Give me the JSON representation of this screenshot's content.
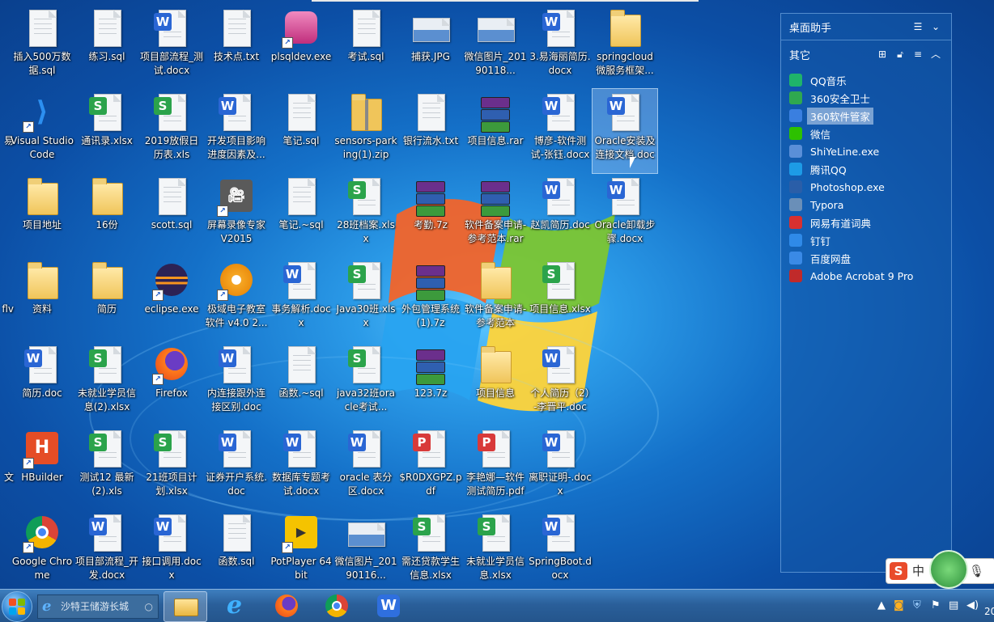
{
  "desktop": {
    "icons": [
      {
        "label": "插入500万数据.sql",
        "type": "doc"
      },
      {
        "label": "练习.sql",
        "type": "doc"
      },
      {
        "label": "项目部流程_测试.docx",
        "type": "word"
      },
      {
        "label": "技术点.txt",
        "type": "doc"
      },
      {
        "label": "plsqldev.exe",
        "type": "db"
      },
      {
        "label": "考试.sql",
        "type": "doc"
      },
      {
        "label": "捕获.JPG",
        "type": "img"
      },
      {
        "label": "微信图片_20190118...",
        "type": "img"
      },
      {
        "label": "3.易海丽简历.docx",
        "type": "word"
      },
      {
        "label": "springcloud微服务框架...",
        "type": "folder"
      },
      {
        "label": "易",
        "type": "partial"
      },
      {
        "label": "Visual Studio Code",
        "type": "vscode"
      },
      {
        "label": "通讯录.xlsx",
        "type": "excel"
      },
      {
        "label": "2019放假日历表.xls",
        "type": "excel"
      },
      {
        "label": "开发项目影响进度因素及...",
        "type": "word"
      },
      {
        "label": "笔记.sql",
        "type": "doc"
      },
      {
        "label": "sensors-parking(1).zip",
        "type": "zip"
      },
      {
        "label": "银行流水.txt",
        "type": "doc"
      },
      {
        "label": "项目信息.rar",
        "type": "rar"
      },
      {
        "label": "博彦-软件测试-张钰.docx",
        "type": "word"
      },
      {
        "label": "Oracle安装及连接文档.doc",
        "type": "word"
      },
      {
        "label": "项目地址",
        "type": "folder"
      },
      {
        "label": "16份",
        "type": "folder"
      },
      {
        "label": "scott.sql",
        "type": "doc"
      },
      {
        "label": "屏幕录像专家V2015",
        "type": "camera"
      },
      {
        "label": "笔记.~sql",
        "type": "doc"
      },
      {
        "label": "28班档案.xlsx",
        "type": "excel"
      },
      {
        "label": "考勤.7z",
        "type": "rar"
      },
      {
        "label": "软件备案申请-参考范本.rar",
        "type": "rar"
      },
      {
        "label": "赵凯简历.doc",
        "type": "word"
      },
      {
        "label": "Oracle卸载步骤.docx",
        "type": "word"
      },
      {
        "label": "flv",
        "type": "partial"
      },
      {
        "label": "资料",
        "type": "folder"
      },
      {
        "label": "简历",
        "type": "folder"
      },
      {
        "label": "eclipse.exe",
        "type": "eclipse"
      },
      {
        "label": "极域电子教室软件 v4.0 2...",
        "type": "orange"
      },
      {
        "label": "事务解析.docx",
        "type": "word"
      },
      {
        "label": "Java30班.xlsx",
        "type": "excel"
      },
      {
        "label": "外包管理系统(1).7z",
        "type": "rar"
      },
      {
        "label": "软件备案申请-参考范本",
        "type": "folder"
      },
      {
        "label": "项目信息.xlsx",
        "type": "excel"
      },
      {
        "label": "简历.doc",
        "type": "word"
      },
      {
        "label": "未就业学员信息(2).xlsx",
        "type": "excel"
      },
      {
        "label": "Firefox",
        "type": "firefox"
      },
      {
        "label": "内连接跟外连接区别.doc",
        "type": "word"
      },
      {
        "label": "函数.~sql",
        "type": "doc"
      },
      {
        "label": "java32班oracle考试...",
        "type": "excel"
      },
      {
        "label": "123.7z",
        "type": "rar"
      },
      {
        "label": "项目信息",
        "type": "folder"
      },
      {
        "label": "个人简历（2）-李晋平.doc",
        "type": "word"
      },
      {
        "label": "文",
        "type": "partial"
      },
      {
        "label": "HBuilder",
        "type": "hbuilder"
      },
      {
        "label": "测试12 最新(2).xls",
        "type": "excel"
      },
      {
        "label": "21班项目计划.xlsx",
        "type": "excel"
      },
      {
        "label": "证券开户系统.doc",
        "type": "word"
      },
      {
        "label": "数据库专题考试.docx",
        "type": "word"
      },
      {
        "label": "oracle 表分区.docx",
        "type": "word"
      },
      {
        "label": "$R0DXGPZ.pdf",
        "type": "pdf"
      },
      {
        "label": "李艳娜—软件测试简历.pdf",
        "type": "pdf"
      },
      {
        "label": "离职证明-.docx",
        "type": "word"
      },
      {
        "label": "Google Chrome",
        "type": "chrome"
      },
      {
        "label": "项目部流程_开发.docx",
        "type": "word"
      },
      {
        "label": "接口调用.docx",
        "type": "word"
      },
      {
        "label": "函数.sql",
        "type": "doc"
      },
      {
        "label": "PotPlayer 64 bit",
        "type": "potplayer"
      },
      {
        "label": "微信图片_20190116...",
        "type": "img"
      },
      {
        "label": "需还贷款学生信息.xlsx",
        "type": "excel"
      },
      {
        "label": "未就业学员信息.xlsx",
        "type": "excel"
      },
      {
        "label": "SpringBoot.docx",
        "type": "word"
      }
    ]
  },
  "panel": {
    "title": "桌面助手",
    "section": "其它",
    "items": [
      {
        "label": "QQ音乐",
        "color": "#1fb36a"
      },
      {
        "label": "360安全卫士",
        "color": "#2fa84f"
      },
      {
        "label": "360软件管家",
        "color": "#3a7fe0"
      },
      {
        "label": "微信",
        "color": "#2dc100"
      },
      {
        "label": "ShiYeLine.exe",
        "color": "#5a8fd8"
      },
      {
        "label": "腾讯QQ",
        "color": "#1d9be6"
      },
      {
        "label": "Photoshop.exe",
        "color": "#2a5ea8"
      },
      {
        "label": "Typora",
        "color": "#6a8fb8"
      },
      {
        "label": "网易有道词典",
        "color": "#d83030"
      },
      {
        "label": "钉钉",
        "color": "#2f8ae8"
      },
      {
        "label": "百度网盘",
        "color": "#3a8ae6"
      },
      {
        "label": "Adobe Acrobat 9 Pro",
        "color": "#c02a2a"
      }
    ]
  },
  "taskbar": {
    "search_placeholder": "沙特王储游长城",
    "clock_partial": "20"
  },
  "ime": {
    "label": "中"
  }
}
